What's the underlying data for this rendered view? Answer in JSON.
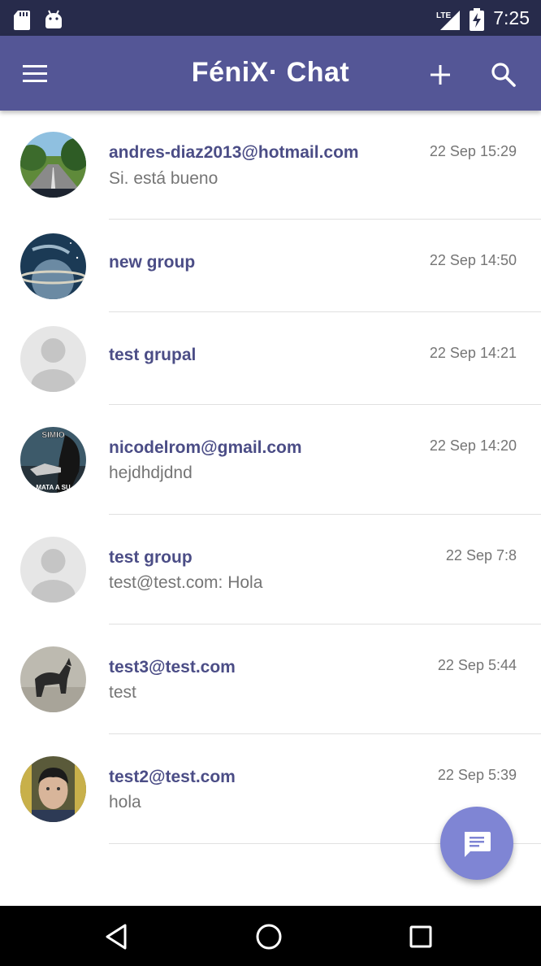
{
  "status_bar": {
    "time": "7:25",
    "network": "LTE",
    "icons": [
      "sd-card-icon",
      "android-icon",
      "signal-icon",
      "battery-charging-icon"
    ]
  },
  "app_bar": {
    "title": "FéniX· Chat",
    "icons": [
      "menu-icon",
      "add-icon",
      "search-icon"
    ]
  },
  "chats": [
    {
      "name": "andres-diaz2013@hotmail.com",
      "preview": "Si. está bueno",
      "time": "22 Sep 15:29",
      "avatar": "road-photo"
    },
    {
      "name": "new group",
      "preview": "",
      "time": "22 Sep 14:50",
      "avatar": "space-planet-photo"
    },
    {
      "name": "test grupal",
      "preview": "",
      "time": "22 Sep 14:21",
      "avatar": "default-person"
    },
    {
      "name": "nicodelrom@gmail.com",
      "preview": "hejdhdjdnd",
      "time": "22 Sep 14:20",
      "avatar": "meme-photo",
      "avatar_caption_top": "SIMIO",
      "avatar_caption_bottom": "MATA A SU"
    },
    {
      "name": "test group",
      "preview": "test@test.com: Hola",
      "time": "22 Sep 7:8",
      "avatar": "default-person"
    },
    {
      "name": "test3@test.com",
      "preview": "test",
      "time": "22 Sep 5:44",
      "avatar": "dog-photo"
    },
    {
      "name": "test2@test.com",
      "preview": "hola",
      "time": "22 Sep 5:39",
      "avatar": "face-photo"
    }
  ],
  "fab": {
    "icon": "message-icon"
  },
  "nav_bar": {
    "icons": [
      "back-icon",
      "home-icon",
      "recents-icon"
    ]
  },
  "colors": {
    "status_bar": "#272b4b",
    "app_bar": "#545696",
    "chat_name": "#4b4d86",
    "secondary_text": "#757575",
    "fab": "#7f85d4"
  }
}
